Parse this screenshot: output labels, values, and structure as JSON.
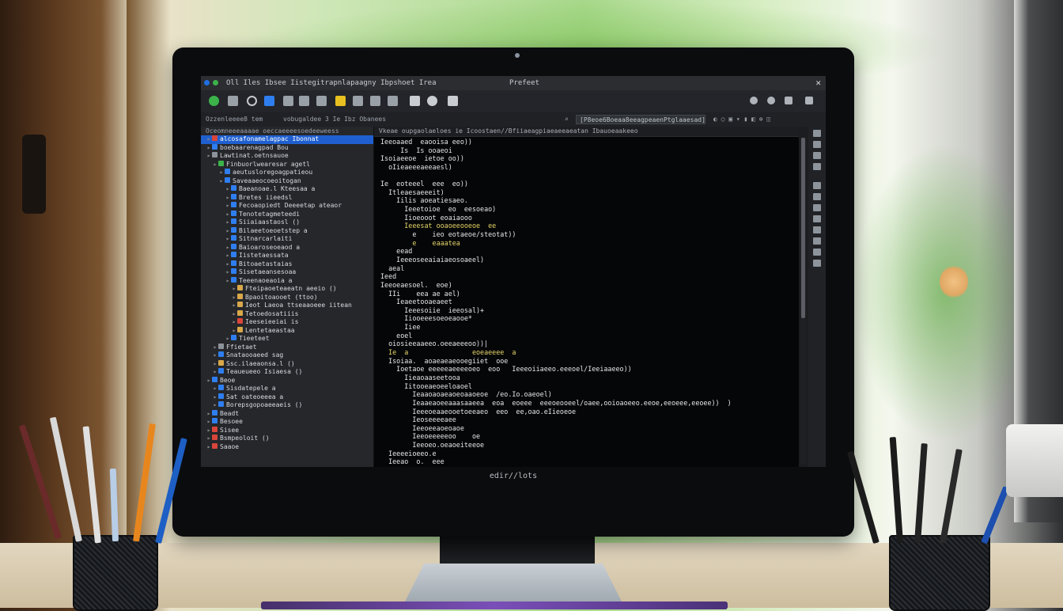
{
  "window": {
    "title": "Prefeet",
    "menu": "Oll Iles Ibsee Iistegitrapnlapaagny Ibpshoet Irea"
  },
  "pathbar": {
    "left": "Ozzenleeee8 tem",
    "breadcrumb": "vobugaldee 3  Ie  Ibz Obanees",
    "search_value": "[P8eoe6Boeaa8eeagpeaenPtglaaesad]"
  },
  "sidebar": {
    "header": "Oceomneeeaaaae  oeccaeeeesoedeeweess",
    "items": [
      {
        "label": "alcosafonamelagpac Ibonnat",
        "depth": 0,
        "icon": "red",
        "selected": true
      },
      {
        "label": "boebaarenagpad  Bou",
        "depth": 0,
        "icon": "blue"
      },
      {
        "label": "Lawtinat.oetnsauoe",
        "depth": 0,
        "icon": "gray"
      },
      {
        "label": "Finbuorlwearesar  agetl",
        "depth": 1,
        "icon": "green"
      },
      {
        "label": "aeutusloregoagpatieou",
        "depth": 2,
        "icon": "blue"
      },
      {
        "label": "Saveaaeocoeoitogan",
        "depth": 2,
        "icon": "blue"
      },
      {
        "label": "Baeanoae.l  Kteesaa  a",
        "depth": 3,
        "icon": "blue"
      },
      {
        "label": "Bretes iieedsl",
        "depth": 3,
        "icon": "blue"
      },
      {
        "label": "Fecoaopiedt Deeeetap ateaor",
        "depth": 3,
        "icon": "blue"
      },
      {
        "label": "Tenotetagmeteedi",
        "depth": 3,
        "icon": "blue"
      },
      {
        "label": "Siiaiaastaosl ()",
        "depth": 3,
        "icon": "blue"
      },
      {
        "label": "Bilaeetoeoetstep  a",
        "depth": 3,
        "icon": "blue"
      },
      {
        "label": "Sitnarcarlaiti",
        "depth": 3,
        "icon": "blue"
      },
      {
        "label": "Baioaroseoeaod  a",
        "depth": 3,
        "icon": "blue"
      },
      {
        "label": "Iistetaessata",
        "depth": 3,
        "icon": "blue"
      },
      {
        "label": "Bitoaetastaias",
        "depth": 3,
        "icon": "blue"
      },
      {
        "label": "Sisetaeansesoaa",
        "depth": 3,
        "icon": "blue"
      },
      {
        "label": "Teeenaoeaoia  a",
        "depth": 3,
        "icon": "blue"
      },
      {
        "label": "Fteipaoeteaeatn  aeeio ()",
        "depth": 4,
        "icon": "amber"
      },
      {
        "label": "Bpaoitoaooet (ttoo)",
        "depth": 4,
        "icon": "amber"
      },
      {
        "label": "Ieot Laeoa  ttseaaoeee iitean",
        "depth": 4,
        "icon": "amber"
      },
      {
        "label": "Tetoedosatiiis",
        "depth": 4,
        "icon": "amber"
      },
      {
        "label": "Ieeseieeiai is",
        "depth": 4,
        "icon": "red"
      },
      {
        "label": "Lentetaeastaa",
        "depth": 4,
        "icon": "amber"
      },
      {
        "label": "Tieeteet",
        "depth": 3,
        "icon": "blue"
      },
      {
        "label": "Ffietaet",
        "depth": 1,
        "icon": "gray"
      },
      {
        "label": "Snataooaeed sag",
        "depth": 1,
        "icon": "blue"
      },
      {
        "label": "Ssc.ilaeaonsa.l ()",
        "depth": 1,
        "icon": "amber"
      },
      {
        "label": "Teaueueeo Isiaesa ()",
        "depth": 1,
        "icon": "blue"
      },
      {
        "label": "Beoe",
        "depth": 0,
        "icon": "blue"
      },
      {
        "label": "Sisdatepele  a",
        "depth": 1,
        "icon": "blue"
      },
      {
        "label": "Sat oateoeeea  a",
        "depth": 1,
        "icon": "blue"
      },
      {
        "label": "Borepsgopoaeeaeis ()",
        "depth": 1,
        "icon": "blue"
      },
      {
        "label": "Beadt",
        "depth": 0,
        "icon": "blue"
      },
      {
        "label": "Besoee",
        "depth": 0,
        "icon": "blue"
      },
      {
        "label": "Sisee",
        "depth": 0,
        "icon": "red"
      },
      {
        "label": "Bsmpeoloit ()",
        "depth": 0,
        "icon": "red"
      },
      {
        "label": "Saaoe",
        "depth": 0,
        "icon": "red"
      }
    ]
  },
  "editor": {
    "tab_path": "Vkeae  oupgaolaeloes  ie  Icoostaen//Bfiiaeagpiaeaeeaeatan Ibauoeaakeeo",
    "lines": [
      "Ieeoaaed  eaooisa eeo))",
      "     Is  Is ooaeoi",
      "Isoiaeeoe  ietoe oo))",
      "  oIieaeeeaeeaesl)",
      "",
      "Ie  eoteeel  eee  eo))",
      "  Itleaesaeeeit)",
      "    Iilis aoeatiesaeo.",
      "      Ieeetoioe  eo  eesoeao)",
      "      Iioeooot eoaiaooo",
      "      Ieeesat ooaoeeooeoe  ee",
      "        e    ieo eotaeoe/steotat))",
      "        e    eaaatea",
      "    eead",
      "    Ieeeoseeaiaiaeosoaeel)",
      "  aeal",
      "Ieed",
      "Ieeoeaesoel.  eoe)",
      "  IIi    eea ae ael)",
      "    Ieaeetooaeaeet",
      "      Ieeesoiie  ieeosal)+",
      "      Iiooeeesoeoeaooe*",
      "      Iiee",
      "    eoel",
      "  oiosieeaaeeo.oeeaeeeoo))|",
      "  Ie  a                eoeaeeee  a",
      "  Isoiaa.  aoaeaeaeooegiiet  ooe",
      "    Ioetaoe eeeeeaeeeeoeo  eoo   Ieeeoiiaeeo.eeeoel/Ieeiaaeeo))",
      "      Iieaoaaseetooa",
      "      Iitooeaeoeeloaoel",
      "        Ieaaoaoaeaoeoaaoeoe  /eo.Io.oaeoel)",
      "        Ieaaeaoeeaaasaaeea  eoa  eoeee  eeeoeooeel/oaee,ooioaoeeo.eeoe,eeoeee,eeoee))  )",
      "        Ieeeoeaaeooetoeeaeo  eeo  ee,oao.eIieoeoe",
      "        Ieoseeeeaee",
      "        Ieeoeeaoeoaoe",
      "        Ieeoeeeeeoo    oe",
      "        Ieeoeo.oeaoeiteeoe",
      "  Ieeeeioeeo.e",
      "  Ieeao  o.  eee",
      "    Iee  eoaeeeoo))",
      "    Ieeeooaa",
      "      Ieeaaeeo.",
      "      Ieee",
      "  eo",
      "Ieeooaeeooeo.eoeaeooe))"
    ]
  },
  "monitor_label": "edir//lots",
  "colors": {
    "selection": "#1f5fcf",
    "editor_bg": "#050607",
    "sidebar_bg": "#25272b",
    "accent_green": "#3cb34a"
  }
}
